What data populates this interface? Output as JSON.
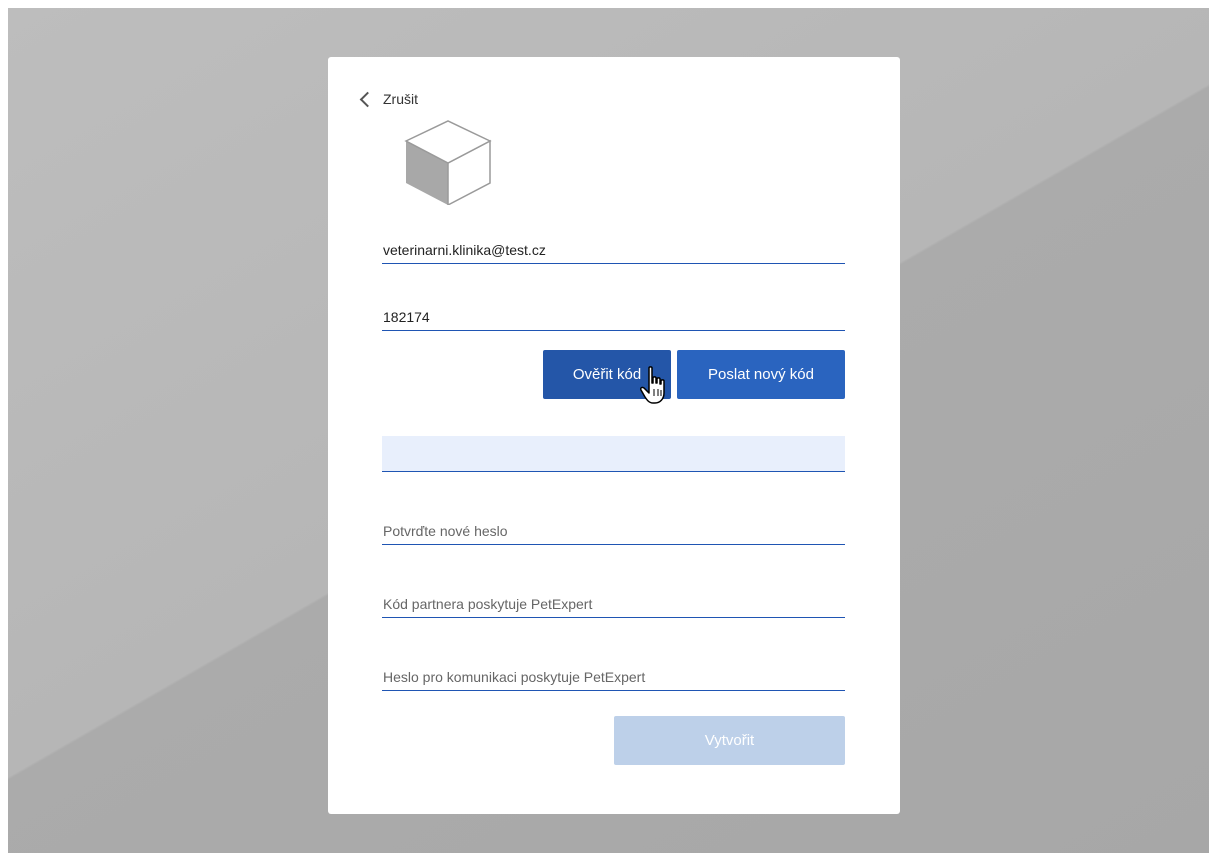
{
  "form": {
    "cancel_label": "Zrušit",
    "logo_icon": "cube-icon",
    "email_value": "veterinarni.klinika@test.cz",
    "code_value": "182174",
    "verify_label": "Ověřit kód",
    "resend_label": "Poslat nový kód",
    "new_password_value": "",
    "confirm_password_placeholder": "Potvrďte nové heslo",
    "partner_code_placeholder": "Kód partnera poskytuje PetExpert",
    "comm_password_placeholder": "Heslo pro komunikaci poskytuje PetExpert",
    "create_label": "Vytvořit"
  },
  "colors": {
    "primary": "#2456a8",
    "secondary_button": "#2a64bf",
    "disabled_button": "#bdd0e9",
    "field_underline": "#1f55b3",
    "active_field_bg": "#e8effc"
  }
}
